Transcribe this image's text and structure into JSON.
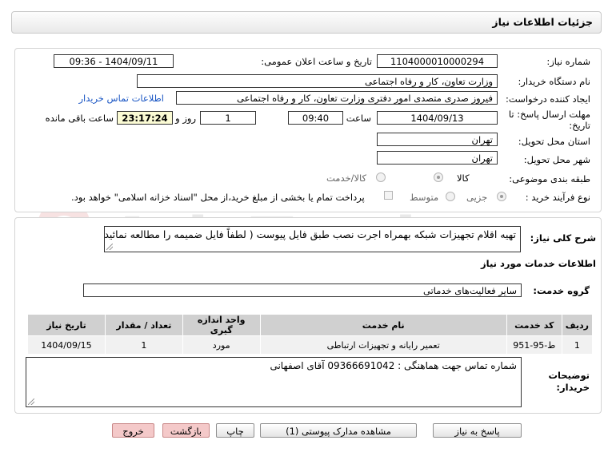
{
  "header": {
    "title": "جزئیات اطلاعات نیاز"
  },
  "form": {
    "need_number_label": "شماره نیاز:",
    "need_number": "1104000010000294",
    "announce_label": "تاریخ و ساعت اعلان عمومی:",
    "announce_value": "1404/09/11 - 09:36",
    "buyer_org_label": "نام دستگاه خریدار:",
    "buyer_org": "وزارت تعاون، کار و رفاه اجتماعی",
    "creator_label": "ایجاد کننده درخواست:",
    "creator": "فیروز صدری متصدی امور دفتری وزارت تعاون، کار و رفاه اجتماعی",
    "contact_link": "اطلاعات تماس خریدار",
    "deadline_label_1": "مهلت ارسال پاسخ: تا",
    "deadline_label_2": "تاریخ:",
    "deadline_date": "1404/09/13",
    "time_label": "ساعت",
    "deadline_time": "09:40",
    "days_value": "1",
    "days_label": "روز و",
    "remaining_time": "23:17:24",
    "remaining_label": "ساعت باقی مانده",
    "province_label": "استان محل تحویل:",
    "province": "تهران",
    "city_label": "شهر محل تحویل:",
    "city": "تهران",
    "category_label": "طبقه بندی موضوعی:",
    "category_options": [
      "کالا",
      "کالا/خدمت"
    ],
    "purchase_type_label": "نوع فرآیند خرید :",
    "purchase_options": [
      "جزیی",
      "متوسط"
    ],
    "payment_note": "پرداخت تمام یا بخشی از مبلغ خرید،از محل \"اسناد خزانه اسلامی\" خواهد بود."
  },
  "details": {
    "description_label": "شرح کلی نیاز:",
    "description": "تهیه اقلام تجهیزات شبکه بهمراه اجرت نصب طبق فایل پیوست ( لطفاً فایل ضمیمه را مطالعه نمائید).",
    "services_heading": "اطلاعات خدمات مورد نیاز",
    "service_group_label": "گروه خدمت:",
    "service_group": "سایر فعالیت‌های خدماتی",
    "table_headers": [
      "ردیف",
      "کد خدمت",
      "نام خدمت",
      "واحد اندازه گیری",
      "تعداد / مقدار",
      "تاریخ نیاز"
    ],
    "rows": [
      [
        "1",
        "ط-95-951",
        "تعمیر رایانه و تجهیزات ارتباطی",
        "مورد",
        "1",
        "1404/09/15"
      ]
    ],
    "buyer_notes_label_1": "توضیحات",
    "buyer_notes_label_2": "خریدار:",
    "buyer_notes": "شماره تماس جهت هماهنگی : 09366691042 آقای اصفهانی"
  },
  "buttons": {
    "reply": "پاسخ به نیاز",
    "attachments": "مشاهده مدارک پیوستی (1)",
    "print": "چاپ",
    "back": "بازگشت",
    "exit": "خروج"
  },
  "watermark": {
    "text": "AriaTender.net"
  },
  "colors": {
    "link": "#1a56c4",
    "remaining_bg": "#fbfbd4",
    "danger_button": "#f4c9c9"
  }
}
